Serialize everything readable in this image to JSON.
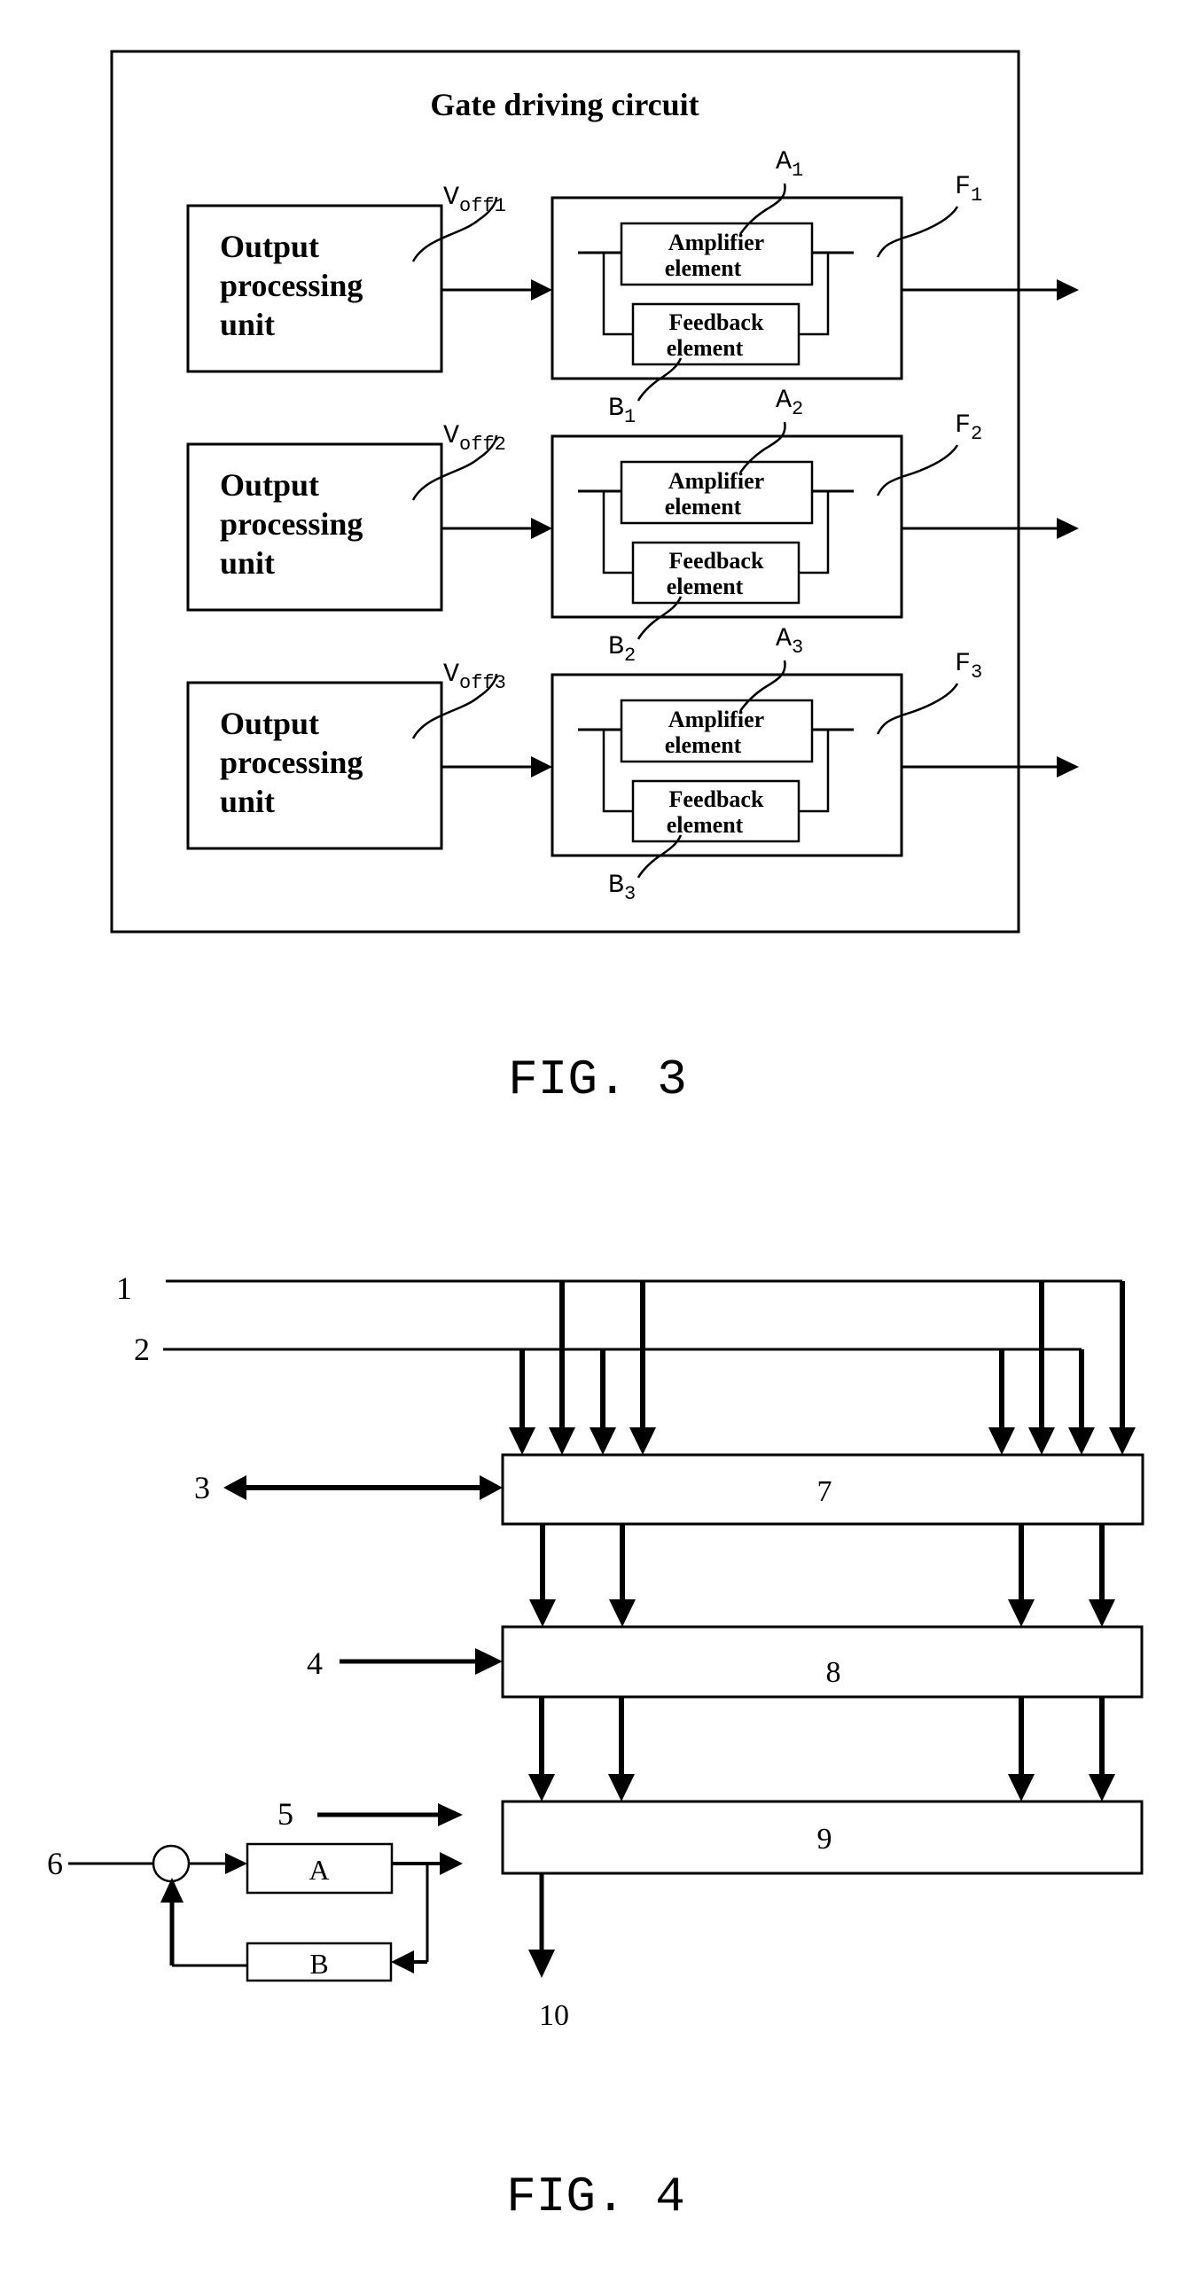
{
  "fig3": {
    "title": "Gate driving circuit",
    "caption": "FIG. 3",
    "rows": [
      {
        "unit_label": [
          "Output",
          "processing",
          "unit"
        ],
        "voltage_label": {
          "main": "V",
          "sub": "off1"
        },
        "amplifier": {
          "label": [
            "Amplifier",
            "element"
          ],
          "ref": {
            "main": "A",
            "sub": "1"
          }
        },
        "feedback": {
          "label": [
            "Feedback",
            "element"
          ],
          "ref": {
            "main": "B",
            "sub": "1"
          }
        },
        "output_ref": {
          "main": "F",
          "sub": "1"
        }
      },
      {
        "unit_label": [
          "Output",
          "processing",
          "unit"
        ],
        "voltage_label": {
          "main": "V",
          "sub": "off2"
        },
        "amplifier": {
          "label": [
            "Amplifier",
            "element"
          ],
          "ref": {
            "main": "A",
            "sub": "2"
          }
        },
        "feedback": {
          "label": [
            "Feedback",
            "element"
          ],
          "ref": {
            "main": "B",
            "sub": "2"
          }
        },
        "output_ref": {
          "main": "F",
          "sub": "2"
        }
      },
      {
        "unit_label": [
          "Output",
          "processing",
          "unit"
        ],
        "voltage_label": {
          "main": "V",
          "sub": "off3"
        },
        "amplifier": {
          "label": [
            "Amplifier",
            "element"
          ],
          "ref": {
            "main": "A",
            "sub": "3"
          }
        },
        "feedback": {
          "label": [
            "Feedback",
            "element"
          ],
          "ref": {
            "main": "B",
            "sub": "3"
          }
        },
        "output_ref": {
          "main": "F",
          "sub": "3"
        }
      }
    ]
  },
  "fig4": {
    "caption": "FIG. 4",
    "signal_labels": {
      "s1": "1",
      "s2": "2",
      "s3": "3",
      "s4": "4",
      "s5": "5",
      "s6": "6",
      "s10": "10"
    },
    "blocks": {
      "b7": "7",
      "b8": "8",
      "b9": "9",
      "a": "A",
      "b": "B"
    }
  }
}
